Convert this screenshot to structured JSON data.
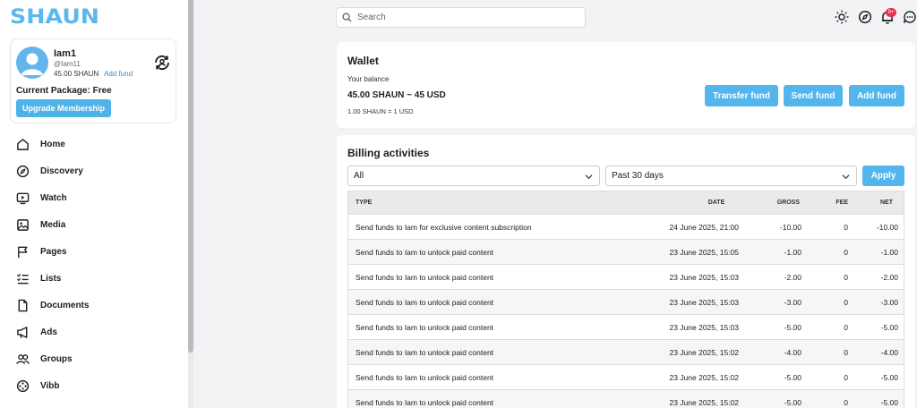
{
  "logo": "SHAUN",
  "profile": {
    "name": "Iam1",
    "handle": "@Iam11",
    "balance": "45.00 SHAUN",
    "add_fund": "Add fund",
    "package": "Current Package: Free",
    "upgrade": "Upgrade Membership"
  },
  "nav": [
    {
      "label": "Home",
      "icon": "home-icon"
    },
    {
      "label": "Discovery",
      "icon": "compass-icon"
    },
    {
      "label": "Watch",
      "icon": "watch-icon"
    },
    {
      "label": "Media",
      "icon": "image-icon"
    },
    {
      "label": "Pages",
      "icon": "flag-icon"
    },
    {
      "label": "Lists",
      "icon": "list-icon"
    },
    {
      "label": "Documents",
      "icon": "document-icon"
    },
    {
      "label": "Ads",
      "icon": "megaphone-icon"
    },
    {
      "label": "Groups",
      "icon": "groups-icon"
    },
    {
      "label": "Vibb",
      "icon": "film-reel-icon"
    }
  ],
  "search": {
    "placeholder": "Search"
  },
  "notifications": {
    "badge": "9+"
  },
  "wallet": {
    "title": "Wallet",
    "your_balance": "Your balance",
    "amount": "45.00 SHAUN ~ 45 USD",
    "rate": "1.00 SHAUN = 1 USD",
    "transfer": "Transfer fund",
    "send": "Send fund",
    "add": "Add fund"
  },
  "billing": {
    "title": "Billing activities",
    "filter_type": "All",
    "filter_period": "Past 30 days",
    "apply": "Apply",
    "columns": {
      "type": "TYPE",
      "date": "DATE",
      "gross": "GROSS",
      "fee": "FEE",
      "net": "NET"
    },
    "rows": [
      {
        "type": "Send funds to Iam for exclusive content subscription",
        "date": "24 June 2025, 21:00",
        "gross": "-10.00",
        "fee": "0",
        "net": "-10.00"
      },
      {
        "type": "Send funds to Iam to unlock paid content",
        "date": "23 June 2025, 15:05",
        "gross": "-1.00",
        "fee": "0",
        "net": "-1.00"
      },
      {
        "type": "Send funds to Iam to unlock paid content",
        "date": "23 June 2025, 15:03",
        "gross": "-2.00",
        "fee": "0",
        "net": "-2.00"
      },
      {
        "type": "Send funds to Iam to unlock paid content",
        "date": "23 June 2025, 15:03",
        "gross": "-3.00",
        "fee": "0",
        "net": "-3.00"
      },
      {
        "type": "Send funds to Iam to unlock paid content",
        "date": "23 June 2025, 15:03",
        "gross": "-5.00",
        "fee": "0",
        "net": "-5.00"
      },
      {
        "type": "Send funds to Iam to unlock paid content",
        "date": "23 June 2025, 15:02",
        "gross": "-4.00",
        "fee": "0",
        "net": "-4.00"
      },
      {
        "type": "Send funds to Iam to unlock paid content",
        "date": "23 June 2025, 15:02",
        "gross": "-5.00",
        "fee": "0",
        "net": "-5.00"
      },
      {
        "type": "Send funds to Iam to unlock paid content",
        "date": "23 June 2025, 15:02",
        "gross": "-5.00",
        "fee": "0",
        "net": "-5.00"
      }
    ]
  }
}
